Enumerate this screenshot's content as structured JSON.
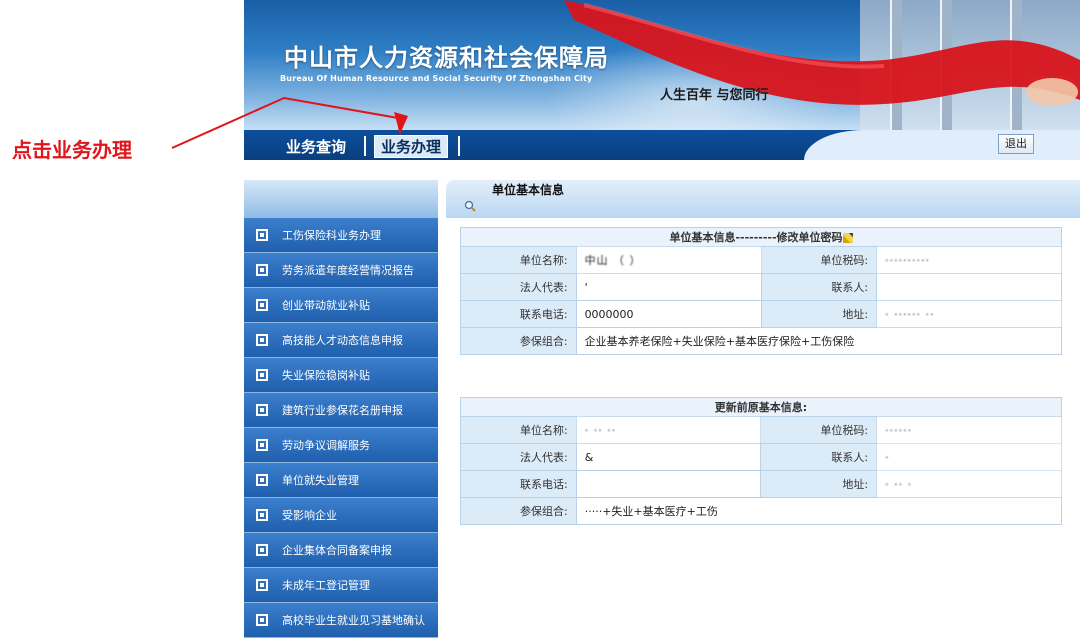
{
  "header": {
    "site_title": "中山市人力资源和社会保障局",
    "site_subtitle": "Bureau Of Human Resource and Social Security Of Zhongshan City",
    "slogan": "人生百年   与您同行"
  },
  "nav": {
    "items": [
      {
        "label": "业务查询"
      },
      {
        "label": "业务办理"
      }
    ],
    "logout_label": "退出"
  },
  "annotation": {
    "text": "点击业务办理",
    "color": "#e0141a"
  },
  "sidebar": {
    "items": [
      {
        "label": "工伤保险科业务办理"
      },
      {
        "label": "劳务派遣年度经营情况报告"
      },
      {
        "label": "创业带动就业补贴"
      },
      {
        "label": "高技能人才动态信息申报"
      },
      {
        "label": "失业保险稳岗补贴"
      },
      {
        "label": "建筑行业参保花名册申报"
      },
      {
        "label": "劳动争议调解服务"
      },
      {
        "label": "单位就失业管理"
      },
      {
        "label": "受影响企业"
      },
      {
        "label": "企业集体合同备案申报"
      },
      {
        "label": "未成年工登记管理"
      },
      {
        "label": "高校毕业生就业见习基地确认"
      }
    ]
  },
  "panel": {
    "title": "单位基本信息"
  },
  "basic_info": {
    "caption": "单位基本信息---------修改单位密码",
    "labels": {
      "name": "单位名称:",
      "tax_id": "单位税码:",
      "legal_rep": "法人代表:",
      "contact": "联系人:",
      "phone": "联系电话:",
      "address": "地址:",
      "insurance": "参保组合:"
    },
    "values": {
      "name": "中山 （ ）",
      "tax_id": "··········",
      "legal_rep": "'",
      "contact": "",
      "phone": "0000000",
      "address": "· ······ ··",
      "insurance": "企业基本养老保险+失业保险+基本医疗保险+工伤保险"
    }
  },
  "previous_info": {
    "caption": "更新前原基本信息:",
    "labels": {
      "name": "单位名称:",
      "tax_id": "单位税码:",
      "legal_rep": "法人代表:",
      "contact": "联系人:",
      "phone": "联系电话:",
      "address": "地址:",
      "insurance": "参保组合:"
    },
    "values": {
      "name": "·  ··   ··",
      "tax_id": "······",
      "legal_rep": "&",
      "contact": "·",
      "phone": "",
      "address": "·   ··  ·",
      "insurance": "·····+失业+基本医疗+工伤"
    }
  },
  "colors": {
    "nav_bg": "#0c4f9c",
    "sidebar_bg": "#2f6fbf",
    "ribbon": "#d8141b"
  }
}
